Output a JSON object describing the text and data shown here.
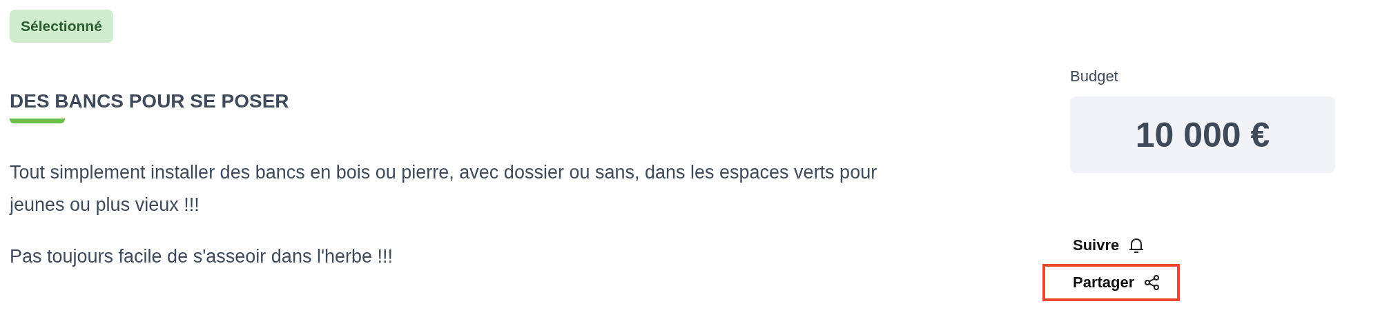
{
  "status_badge": {
    "label": "Sélectionné"
  },
  "title": "DES BANCS POUR SE POSER",
  "description": [
    "Tout simplement installer des bancs en bois ou pierre, avec dossier ou sans, dans les espaces verts pour jeunes ou plus vieux !!!",
    "Pas toujours facile de s'asseoir dans l'herbe !!!"
  ],
  "budget": {
    "label": "Budget",
    "amount": "10 000 €"
  },
  "actions": [
    {
      "kind": "follow",
      "label": "Suivre",
      "highlighted": false
    },
    {
      "kind": "share",
      "label": "Partager",
      "highlighted": true
    }
  ]
}
